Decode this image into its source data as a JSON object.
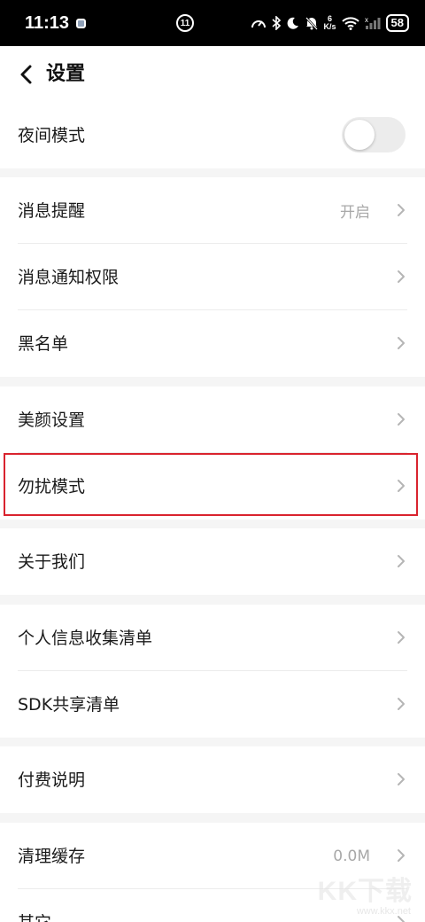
{
  "status_bar": {
    "time": "11:13",
    "notification_badge": "11",
    "net_speed_value": "6",
    "net_speed_unit": "K/s",
    "wifi_extra": "x",
    "battery": "58",
    "icons": [
      "app-notification-icon",
      "data-saver-icon",
      "bluetooth-icon",
      "do-not-disturb-icon",
      "mute-icon",
      "wifi-icon",
      "signal-icon"
    ]
  },
  "header": {
    "back_icon": "chevron-left-icon",
    "title": "设置"
  },
  "settings": {
    "night_mode": {
      "label": "夜间模式",
      "enabled": false
    },
    "message_reminder": {
      "label": "消息提醒",
      "value": "开启"
    },
    "notification_permission": {
      "label": "消息通知权限"
    },
    "blacklist": {
      "label": "黑名单"
    },
    "beauty_settings": {
      "label": "美颜设置"
    },
    "do_not_disturb": {
      "label": "勿扰模式"
    },
    "about_us": {
      "label": "关于我们"
    },
    "personal_info_list": {
      "label": "个人信息收集清单"
    },
    "sdk_share_list": {
      "label": "SDK共享清单"
    },
    "payment_info": {
      "label": "付费说明"
    },
    "clear_cache": {
      "label": "清理缓存",
      "value": "0.0M"
    },
    "other": {
      "label": "其它"
    }
  },
  "watermark": {
    "brand": "KK下载",
    "url": "www.kkx.net"
  },
  "colors": {
    "highlight": "#d9232e",
    "value_text": "#a8a8a8",
    "group_gap": "#f5f5f5"
  }
}
